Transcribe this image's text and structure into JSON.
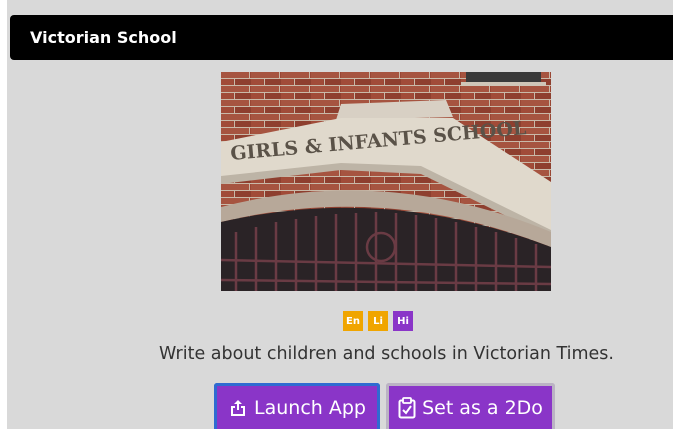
{
  "header": {
    "title": "Victorian School"
  },
  "image": {
    "caption_on_sign": "GIRLS & INFANTS SCHOOL"
  },
  "tags": [
    {
      "label": "En",
      "color": "#f0a500"
    },
    {
      "label": "Li",
      "color": "#f0a500"
    },
    {
      "label": "Hi",
      "color": "#8a35c8"
    }
  ],
  "description": "Write about children and schools in Victorian Times.",
  "buttons": {
    "launch": {
      "label": "Launch App",
      "icon": "share-icon"
    },
    "todo": {
      "label": "Set as a 2Do",
      "icon": "clipboard-check-icon"
    }
  },
  "colors": {
    "header_bg": "#000000",
    "panel_bg": "#d9d9d9",
    "accent": "#8a35c8",
    "focus": "#2f6bd1"
  }
}
